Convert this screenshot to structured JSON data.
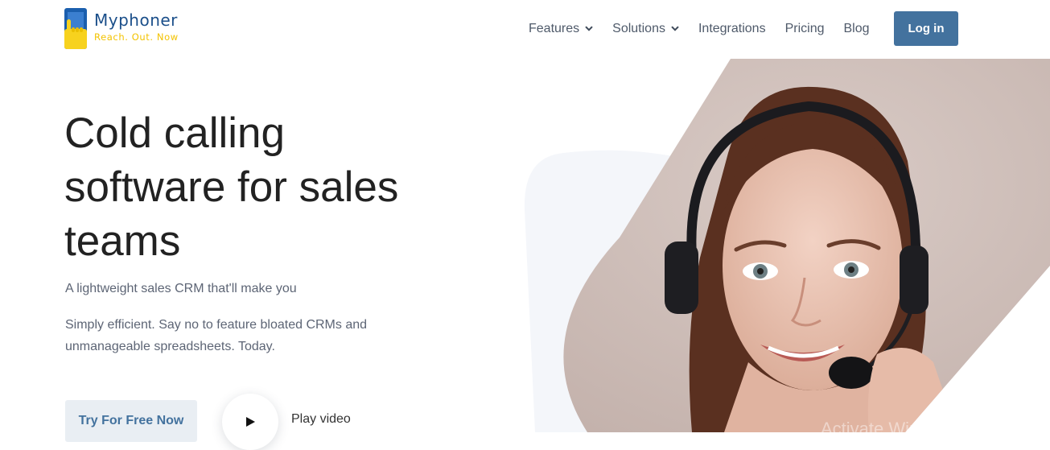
{
  "header": {
    "logo": {
      "name": "Myphoner",
      "tagline": "Reach. Out. Now"
    },
    "nav": [
      {
        "label": "Features",
        "has_dropdown": true,
        "icon": "chevron-down-icon"
      },
      {
        "label": "Solutions",
        "has_dropdown": true,
        "icon": "chevron-down-icon"
      },
      {
        "label": "Integrations",
        "has_dropdown": false
      },
      {
        "label": "Pricing",
        "has_dropdown": false
      },
      {
        "label": "Blog",
        "has_dropdown": false
      }
    ],
    "login_label": "Log in"
  },
  "hero": {
    "title_lines": [
      "Cold calling",
      "software for sales",
      "teams"
    ],
    "subtitle": "A lightweight sales CRM that'll make you",
    "description": "Simply efficient. Say no to feature bloated CRMs and unmanageable spreadsheets. Today.",
    "cta_label": "Try For Free Now",
    "play_label": "Play video",
    "play_icon": "play-icon",
    "image": "woman-with-headset-photo"
  },
  "overlay": {
    "watermark": "Activate Windows"
  },
  "colors": {
    "brand_blue": "#1b4f8a",
    "brand_yellow": "#f3c300",
    "login_bg": "#43729e",
    "cta_bg": "#e9eef3",
    "cta_text": "#43729e",
    "nav_text": "#4f5a6a",
    "body_text": "#5d6575"
  }
}
